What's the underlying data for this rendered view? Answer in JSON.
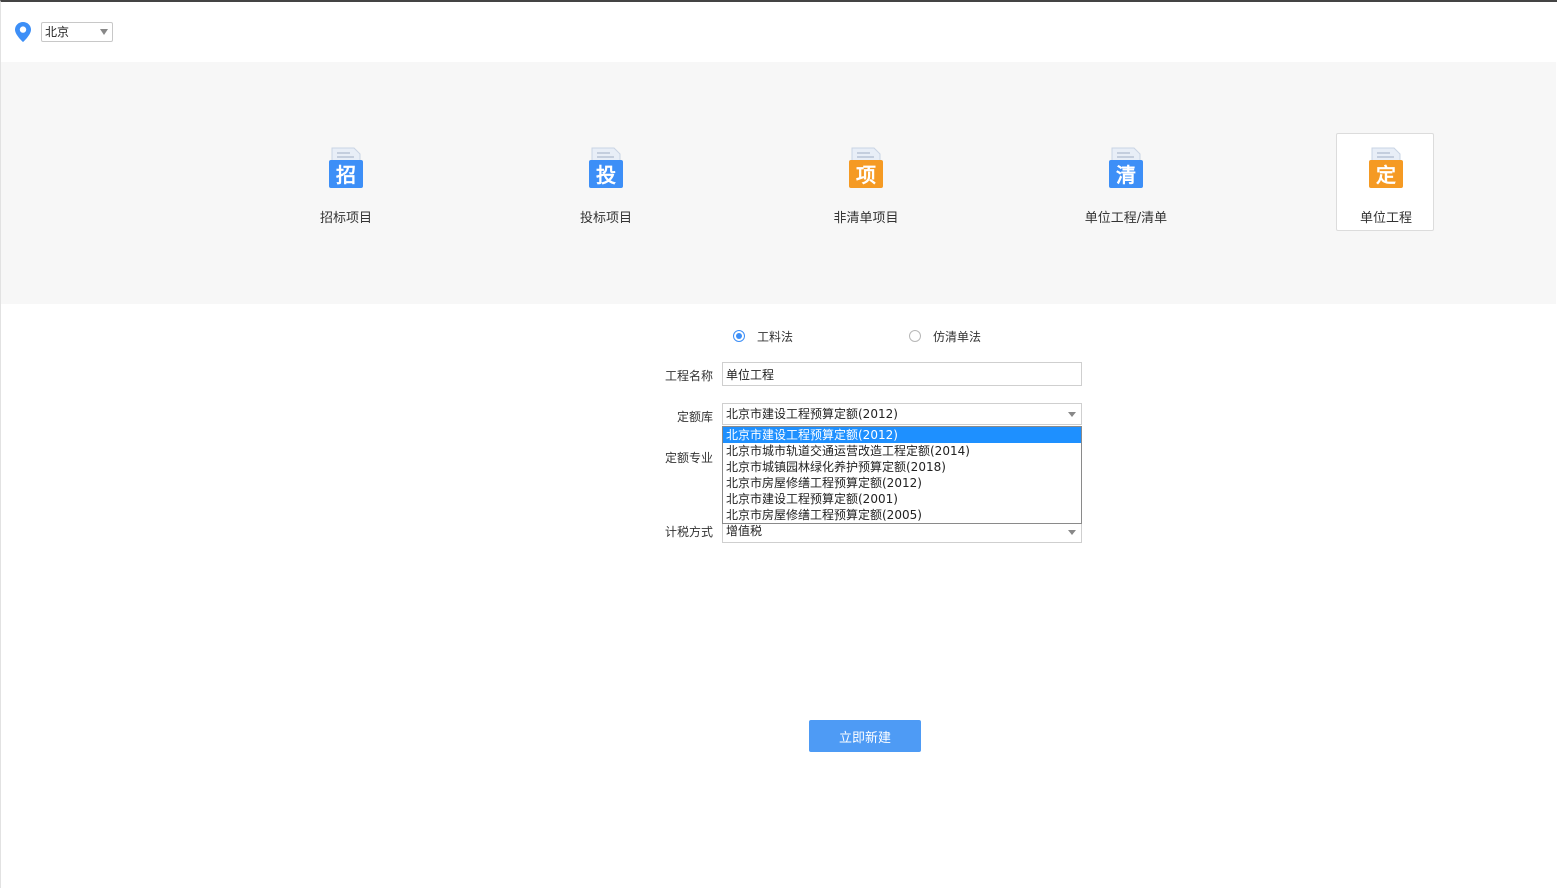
{
  "location": {
    "city": "北京"
  },
  "project_types": [
    {
      "label": "招标项目",
      "glyph": "招",
      "color": "#3d8ff7",
      "selected": false
    },
    {
      "label": "投标项目",
      "glyph": "投",
      "color": "#3d8ff7",
      "selected": false
    },
    {
      "label": "非清单项目",
      "glyph": "项",
      "color": "#f59a23",
      "selected": false
    },
    {
      "label": "单位工程/清单",
      "glyph": "清",
      "color": "#3d8ff7",
      "selected": false
    },
    {
      "label": "单位工程",
      "glyph": "定",
      "color": "#f59a23",
      "selected": true
    }
  ],
  "method": {
    "options": [
      {
        "label": "工料法",
        "checked": true
      },
      {
        "label": "仿清单法",
        "checked": false
      }
    ]
  },
  "form": {
    "project_name_label": "工程名称",
    "project_name_value": "单位工程",
    "quota_library_label": "定额库",
    "quota_library_value": "北京市建设工程预算定额(2012)",
    "quota_major_label": "定额专业",
    "tax_method_label": "计税方式",
    "tax_method_value": "增值税"
  },
  "quota_library_options": [
    "北京市建设工程预算定额(2012)",
    "北京市城市轨道交通运营改造工程定额(2014)",
    "北京市城镇园林绿化养护预算定额(2018)",
    "北京市房屋修缮工程预算定额(2012)",
    "北京市建设工程预算定额(2001)",
    "北京市房屋修缮工程预算定额(2005)"
  ],
  "actions": {
    "create_label": "立即新建"
  },
  "colors": {
    "accent": "#3d8ff7",
    "orange": "#f59a23",
    "button": "#4e9bf5",
    "highlight": "#1e90ff"
  }
}
